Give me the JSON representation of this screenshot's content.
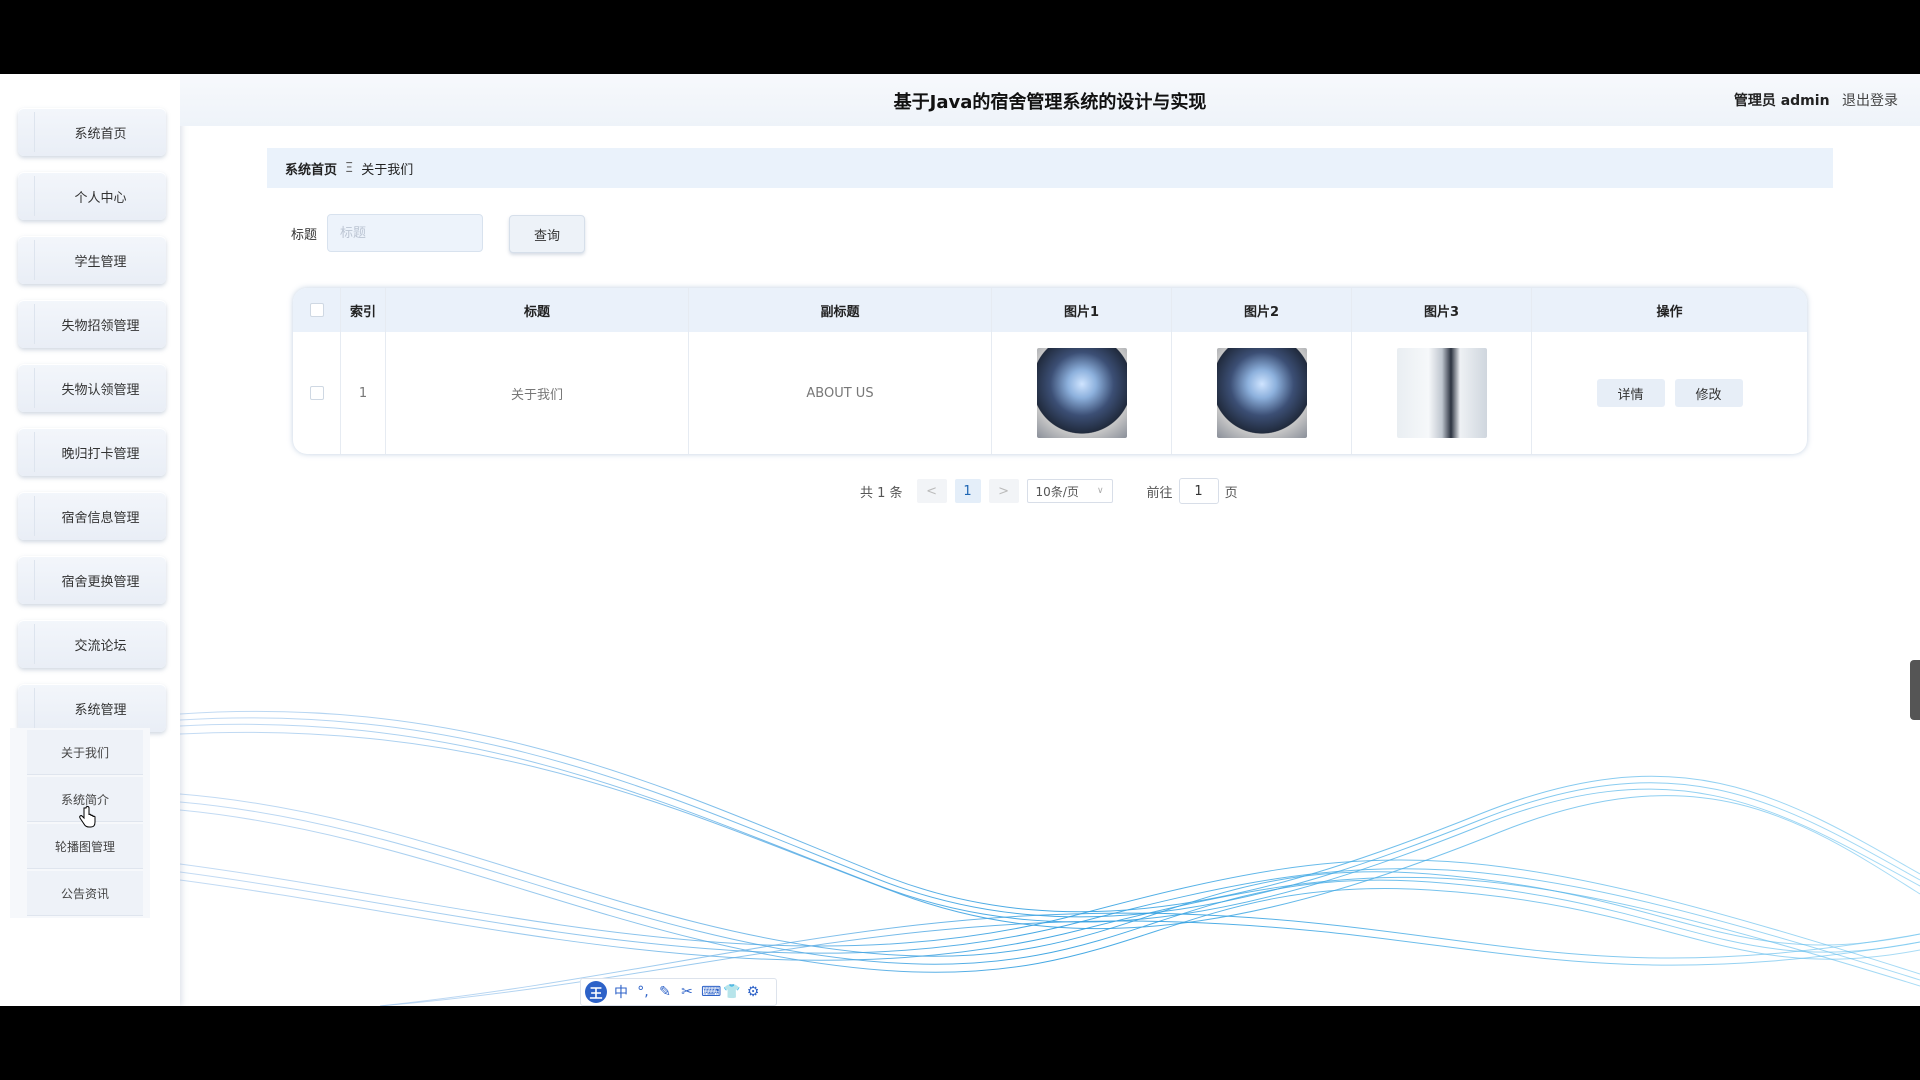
{
  "app": {
    "title": "基于Java的宿舍管理系统的设计与实现",
    "user_role": "管理员 admin",
    "logout": "退出登录"
  },
  "sidebar": {
    "items": [
      {
        "label": "系统首页"
      },
      {
        "label": "个人中心"
      },
      {
        "label": "学生管理"
      },
      {
        "label": "失物招领管理"
      },
      {
        "label": "失物认领管理"
      },
      {
        "label": "晚归打卡管理"
      },
      {
        "label": "宿舍信息管理"
      },
      {
        "label": "宿舍更换管理"
      },
      {
        "label": "交流论坛"
      },
      {
        "label": "系统管理"
      }
    ],
    "subitems": [
      {
        "label": "关于我们"
      },
      {
        "label": "系统简介"
      },
      {
        "label": "轮播图管理"
      },
      {
        "label": "公告资讯"
      }
    ]
  },
  "breadcrumb": {
    "home": "系统首页",
    "separator": "Ξ",
    "current": "关于我们"
  },
  "search": {
    "label": "标题",
    "placeholder": "标题",
    "button": "查询"
  },
  "table": {
    "headers": [
      "索引",
      "标题",
      "副标题",
      "图片1",
      "图片2",
      "图片3",
      "操作"
    ],
    "rows": [
      {
        "index": "1",
        "title": "关于我们",
        "subtitle": "ABOUT US",
        "ops": [
          "详情",
          "修改"
        ]
      }
    ]
  },
  "pagination": {
    "total": "共 1 条",
    "prev": "<",
    "page": "1",
    "next": ">",
    "page_size": "10条/页",
    "goto_label": "前往",
    "goto_value": "1",
    "page_unit": "页"
  },
  "ime": {
    "logo": "王",
    "lang": "中"
  },
  "colors": {
    "accent": "#1e66b4",
    "header_bg": "#eaf1fa",
    "wave": "#3aa0e0"
  }
}
